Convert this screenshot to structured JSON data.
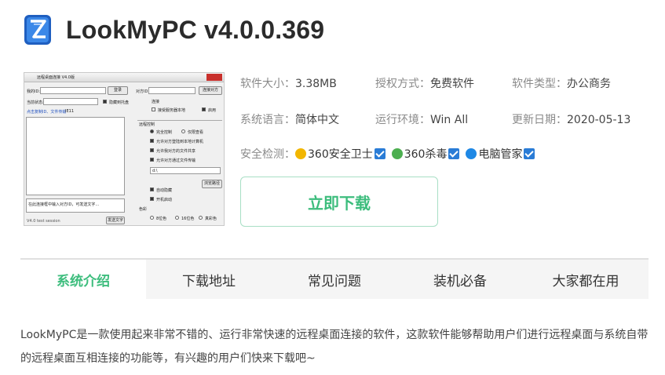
{
  "header": {
    "title": "LookMyPC v4.0.0.369",
    "icon": "lookmypc-app-icon",
    "icon_color": "#2a6fd6"
  },
  "thumbnail": {
    "window_title": "远程桌面连接 V4.0版",
    "fields": {
      "my_id": "我的ID:",
      "peer_id": "对方ID:",
      "status": "当前状态:",
      "login_btn": "登录",
      "connect_btn": "连接对方",
      "tray": "隐藏到托盘",
      "connect_section": "连接",
      "link_text": "点击复制ID、文件传输",
      "ie_label": "IE11",
      "accept": "接受服务器本地",
      "enable": "启用",
      "remote_control": "远程控制",
      "options": [
        "完全控制",
        "仅限查看",
        "允许对方登陆到本地计算机",
        "允许我对方的文件共享",
        "允许对方通过文件传输"
      ],
      "path": "d:\\",
      "browse_btn": "浏览路径",
      "auto_hide": "自动隐藏",
      "auto_start": "开机启动",
      "hint": "在此连接框中输入对方ID，可发送文字…",
      "send_btn": "发送文字",
      "color_label": "色彩",
      "color_opts": [
        "8位色",
        "16位色",
        "真彩色"
      ],
      "footer": "V4.0 test session"
    }
  },
  "info": {
    "size_label": "软件大小：",
    "size_value": "3.38MB",
    "license_label": "授权方式：",
    "license_value": "免费软件",
    "type_label": "软件类型：",
    "type_value": "办公商务",
    "lang_label": "系统语言：",
    "lang_value": "简体中文",
    "env_label": "运行环境：",
    "env_value": "Win All",
    "date_label": "更新日期：",
    "date_value": "2020-05-13",
    "safety_label": "安全检测：",
    "safety_items": [
      {
        "name": "360安全卫士",
        "color": "#f2b600"
      },
      {
        "name": "360杀毒",
        "color": "#4caf50"
      },
      {
        "name": "电脑管家",
        "color": "#1e88e5"
      }
    ]
  },
  "download_label": "立即下载",
  "tabs": [
    "系统介绍",
    "下载地址",
    "常见问题",
    "装机必备",
    "大家都在用"
  ],
  "active_tab": 0,
  "intro": "LookMyPC是一款使用起来非常不错的、运行非常快速的远程桌面连接的软件，这款软件能够帮助用户们进行远程桌面与系统自带的远程桌面互相连接的功能等，有兴趣的用户们快来下载吧~",
  "colors": {
    "accent": "#3dbd7d",
    "check": "#2a7cd6"
  }
}
